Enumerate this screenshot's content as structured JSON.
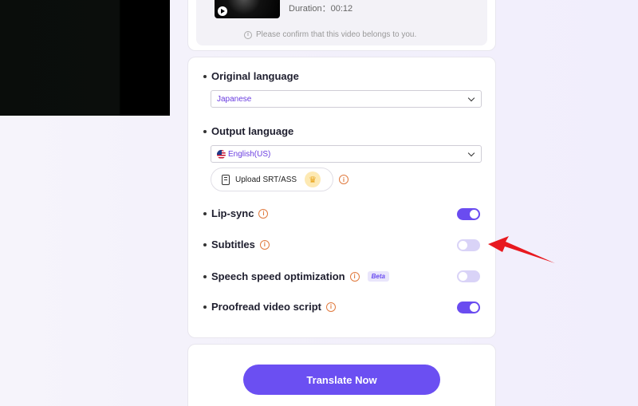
{
  "video": {
    "duration_text": "Duration：00:12",
    "confirm_text": "Please confirm that this video belongs to you."
  },
  "settings": {
    "original_language": {
      "title": "Original language",
      "selected": "Japanese"
    },
    "output_language": {
      "title": "Output language",
      "selected": "English(US)"
    },
    "upload_button_label": "Upload SRT/ASS",
    "toggles": [
      {
        "label": "Lip-sync",
        "on": true
      },
      {
        "label": "Subtitles",
        "on": false
      },
      {
        "label": "Speech speed optimization",
        "on": false,
        "badge": "Beta"
      },
      {
        "label": "Proofread video script",
        "on": true
      }
    ]
  },
  "actions": {
    "translate_label": "Translate Now"
  },
  "colors": {
    "accent": "#6b4ff2",
    "toggle_off": "#d9d3f7",
    "info_orange": "#e07a3e",
    "annotation_arrow": "#e8191f"
  },
  "icons": [
    "play-icon",
    "info-icon",
    "chevron-down-icon",
    "us-flag-icon",
    "document-icon",
    "crown-icon",
    "red-arrow-icon"
  ]
}
